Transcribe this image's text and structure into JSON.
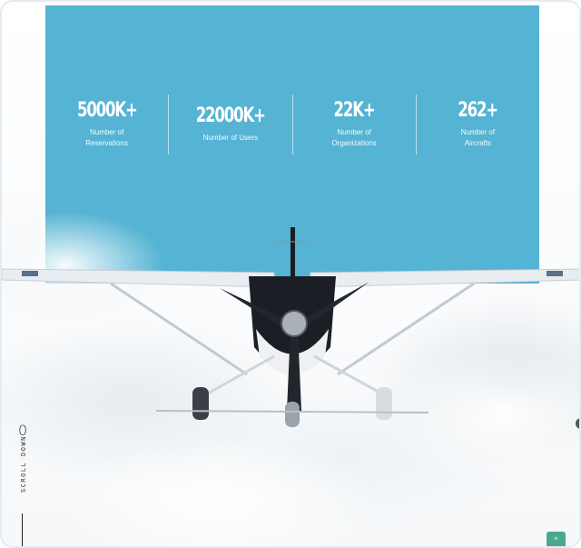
{
  "stats": [
    {
      "value": "5000K+",
      "label": "Number of Reservations"
    },
    {
      "value": "22000K+",
      "label": "Number of Users"
    },
    {
      "value": "22K+",
      "label": "Number of Organizations"
    },
    {
      "value": "262+",
      "label": "Number of Aircrafts"
    }
  ],
  "scroll": {
    "counter": "0",
    "label": "SCROLL DOWN"
  },
  "back_to_top": {
    "icon": "^"
  },
  "colors": {
    "panel": "#55b3d3",
    "back_to_top": "#4aa88e"
  }
}
